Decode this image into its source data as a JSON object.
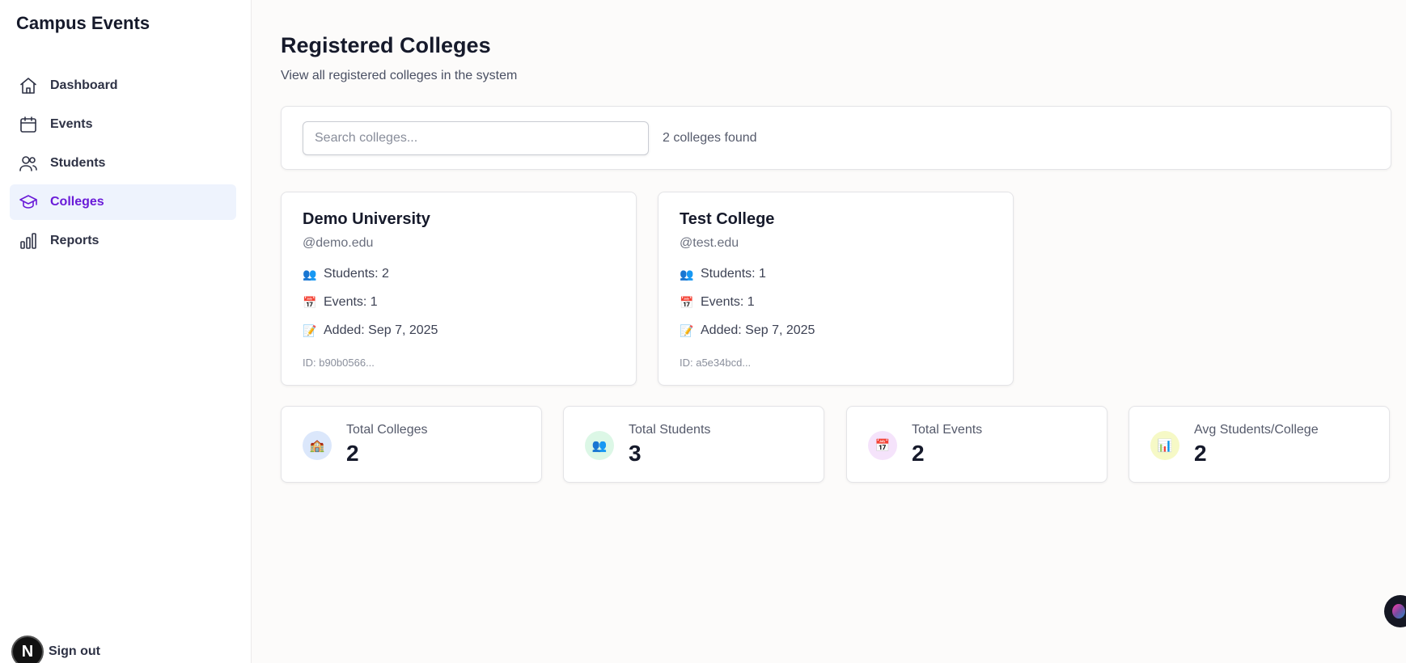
{
  "app": {
    "title": "Campus Events"
  },
  "sidebar": {
    "items": [
      {
        "label": "Dashboard",
        "icon": "home-icon",
        "active": false
      },
      {
        "label": "Events",
        "icon": "calendar-icon",
        "active": false
      },
      {
        "label": "Students",
        "icon": "users-icon",
        "active": false
      },
      {
        "label": "Colleges",
        "icon": "graduation-cap-icon",
        "active": true
      },
      {
        "label": "Reports",
        "icon": "bar-chart-icon",
        "active": false
      }
    ],
    "signout_label": "Sign out",
    "avatar_letter": "N"
  },
  "header": {
    "title": "Registered Colleges",
    "subtitle": "View all registered colleges in the system"
  },
  "search": {
    "placeholder": "Search colleges...",
    "value": "",
    "result_count": "2 colleges found"
  },
  "colleges": [
    {
      "name": "Demo University",
      "domain": "@demo.edu",
      "students": "Students: 2",
      "events": "Events: 1",
      "added": "Added: Sep 7, 2025",
      "id": "ID: b90b0566..."
    },
    {
      "name": "Test College",
      "domain": "@test.edu",
      "students": "Students: 1",
      "events": "Events: 1",
      "added": "Added: Sep 7, 2025",
      "id": "ID: a5e34bcd..."
    }
  ],
  "summary": [
    {
      "label": "Total Colleges",
      "value": "2",
      "icon": "school-icon",
      "color": "#dbe7fb"
    },
    {
      "label": "Total Students",
      "value": "3",
      "icon": "users-icon",
      "color": "#dcf7e6"
    },
    {
      "label": "Total Events",
      "value": "2",
      "icon": "calendar-icon",
      "color": "#f5e3fb"
    },
    {
      "label": "Avg Students/College",
      "value": "2",
      "icon": "bar-chart-icon",
      "color": "#f6f9c6"
    }
  ],
  "colors": {
    "accent": "#6a1bd8",
    "active_bg": "#eef3fd"
  }
}
